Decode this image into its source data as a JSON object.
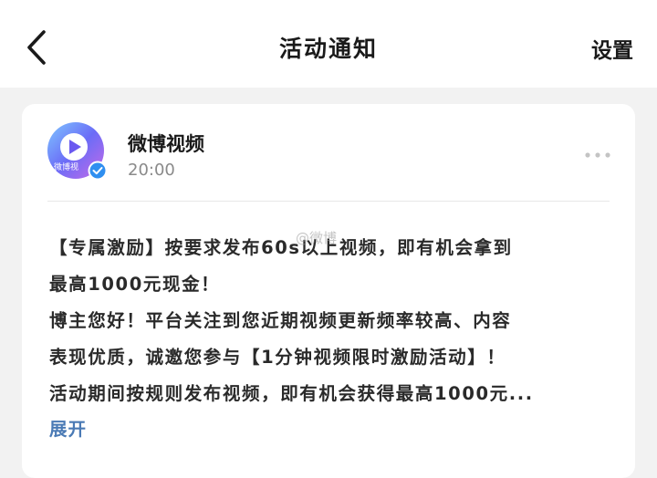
{
  "header": {
    "title": "活动通知",
    "settings_label": "设置",
    "back_icon": "chevron-left-icon"
  },
  "message": {
    "sender": "微博视频",
    "time": "20:00",
    "avatar_label": "微博视",
    "lines": [
      "【专属激励】按要求发布60s以上视频，即有机会拿到",
      "最高1000元现金！",
      "博主您好！平台关注到您近期视频更新频率较高、内容",
      "表现优质，诚邀您参与【1分钟视频限时激励活动】！",
      "活动期间按规则发布视频，即有机会获得最高1000元..."
    ],
    "expand_label": "展开",
    "watermark": "@微博",
    "more_icon": "more-dots-icon"
  },
  "colors": {
    "background": "#f2f2f2",
    "card": "#ffffff",
    "link": "#4a7ab5",
    "verified": "#2f8ff0"
  }
}
